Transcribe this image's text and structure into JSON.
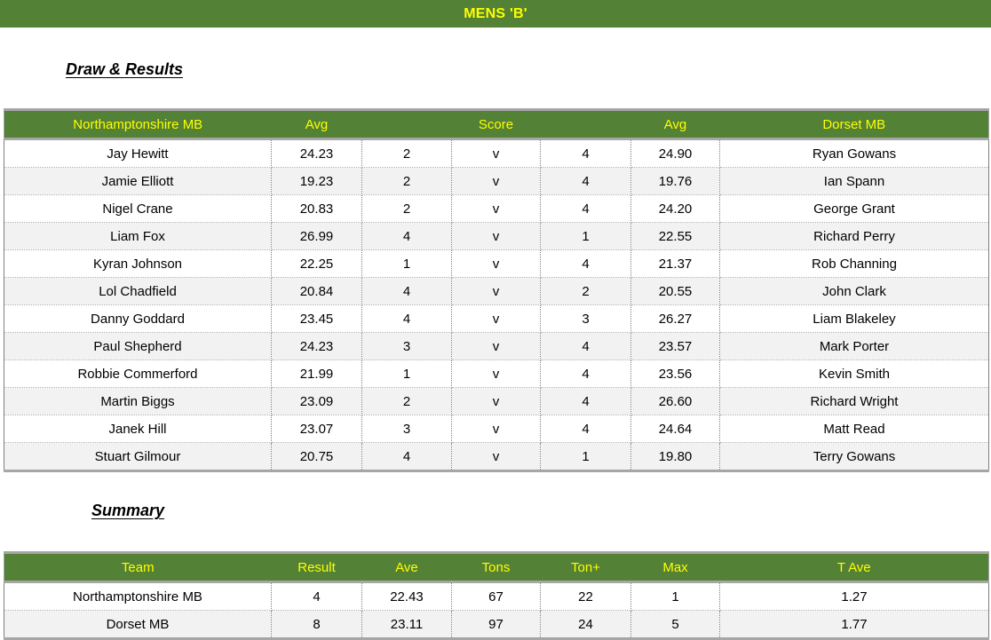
{
  "banner": {
    "title": "MENS 'B'"
  },
  "sections": {
    "draw_heading": "Draw & Results",
    "summary_heading": "Summary"
  },
  "colors": {
    "header_green": "#538135",
    "header_text_yellow": "#ffff00",
    "row_alt": "#f2f2f2",
    "row_plain": "#ffffff",
    "border_gray": "#a6a6a6"
  },
  "draw_table": {
    "columns": [
      "Northamptonshire MB",
      "Avg",
      "",
      "Score",
      "",
      "Avg",
      "Dorset MB"
    ],
    "rows": [
      {
        "home_player": "Jay Hewitt",
        "home_avg": "24.23",
        "home_score": "2",
        "v": "v",
        "away_score": "4",
        "away_avg": "24.90",
        "away_player": "Ryan Gowans"
      },
      {
        "home_player": "Jamie Elliott",
        "home_avg": "19.23",
        "home_score": "2",
        "v": "v",
        "away_score": "4",
        "away_avg": "19.76",
        "away_player": "Ian Spann"
      },
      {
        "home_player": "Nigel Crane",
        "home_avg": "20.83",
        "home_score": "2",
        "v": "v",
        "away_score": "4",
        "away_avg": "24.20",
        "away_player": "George Grant"
      },
      {
        "home_player": "Liam Fox",
        "home_avg": "26.99",
        "home_score": "4",
        "v": "v",
        "away_score": "1",
        "away_avg": "22.55",
        "away_player": "Richard Perry"
      },
      {
        "home_player": "Kyran Johnson",
        "home_avg": "22.25",
        "home_score": "1",
        "v": "v",
        "away_score": "4",
        "away_avg": "21.37",
        "away_player": "Rob Channing"
      },
      {
        "home_player": "Lol Chadfield",
        "home_avg": "20.84",
        "home_score": "4",
        "v": "v",
        "away_score": "2",
        "away_avg": "20.55",
        "away_player": "John Clark"
      },
      {
        "home_player": "Danny Goddard",
        "home_avg": "23.45",
        "home_score": "4",
        "v": "v",
        "away_score": "3",
        "away_avg": "26.27",
        "away_player": "Liam Blakeley"
      },
      {
        "home_player": "Paul Shepherd",
        "home_avg": "24.23",
        "home_score": "3",
        "v": "v",
        "away_score": "4",
        "away_avg": "23.57",
        "away_player": "Mark Porter"
      },
      {
        "home_player": "Robbie Commerford",
        "home_avg": "21.99",
        "home_score": "1",
        "v": "v",
        "away_score": "4",
        "away_avg": "23.56",
        "away_player": "Kevin Smith"
      },
      {
        "home_player": "Martin Biggs",
        "home_avg": "23.09",
        "home_score": "2",
        "v": "v",
        "away_score": "4",
        "away_avg": "26.60",
        "away_player": "Richard Wright"
      },
      {
        "home_player": "Janek Hill",
        "home_avg": "23.07",
        "home_score": "3",
        "v": "v",
        "away_score": "4",
        "away_avg": "24.64",
        "away_player": "Matt Read"
      },
      {
        "home_player": "Stuart Gilmour",
        "home_avg": "20.75",
        "home_score": "4",
        "v": "v",
        "away_score": "1",
        "away_avg": "19.80",
        "away_player": "Terry Gowans"
      }
    ]
  },
  "summary_table": {
    "columns": [
      "Team",
      "Result",
      "Ave",
      "Tons",
      "Ton+",
      "Max",
      "T Ave"
    ],
    "rows": [
      {
        "team": "Northamptonshire MB",
        "result": "4",
        "ave": "22.43",
        "tons": "67",
        "ton_plus": "22",
        "max": "1",
        "t_ave": "1.27"
      },
      {
        "team": "Dorset MB",
        "result": "8",
        "ave": "23.11",
        "tons": "97",
        "ton_plus": "24",
        "max": "5",
        "t_ave": "1.77"
      }
    ]
  }
}
